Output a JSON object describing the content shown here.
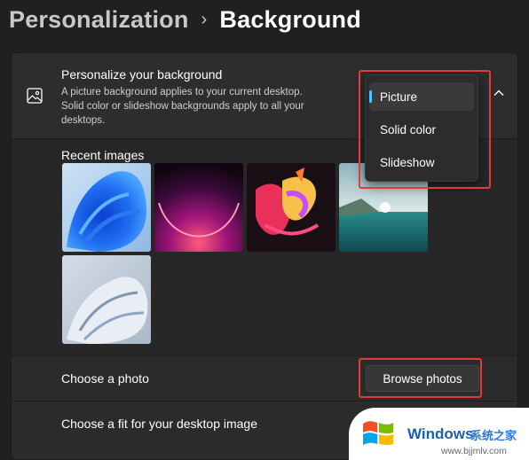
{
  "breadcrumb": {
    "parent": "Personalization",
    "separator": "›",
    "current": "Background"
  },
  "personalize_row": {
    "icon": "picture-icon",
    "title": "Personalize your background",
    "description": "A picture background applies to your current desktop. Solid color or slideshow backgrounds apply to all your desktops.",
    "dropdown": {
      "options": [
        "Picture",
        "Solid color",
        "Slideshow"
      ],
      "selected": "Picture"
    }
  },
  "recent_images": {
    "label": "Recent images",
    "images": [
      {
        "name": "blue-bloom-wallpaper"
      },
      {
        "name": "purple-glow-wallpaper"
      },
      {
        "name": "colorful-abstract-wallpaper"
      },
      {
        "name": "sea-landscape-wallpaper"
      },
      {
        "name": "white-bloom-wallpaper"
      }
    ]
  },
  "choose_photo": {
    "label": "Choose a photo",
    "button_label": "Browse photos"
  },
  "choose_fit": {
    "label": "Choose a fit for your desktop image"
  },
  "watermark": {
    "brand": "Windows",
    "site_name": "系统之家",
    "url": "www.bjjmlv.com"
  },
  "colors": {
    "accent": "#4cc2ff",
    "highlight": "#e03c3c",
    "background": "#202020"
  }
}
